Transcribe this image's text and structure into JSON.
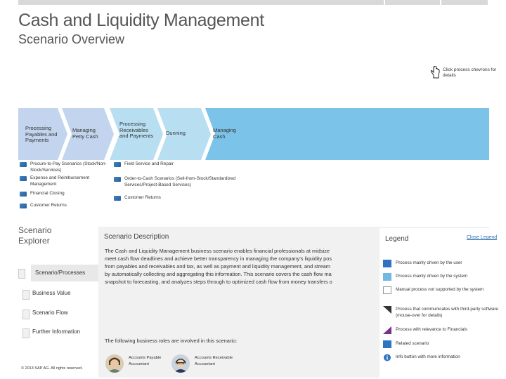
{
  "header": {
    "title": "Cash and Liquidity Management",
    "subtitle": "Scenario Overview"
  },
  "hint": {
    "text": "Click process chevrons for details",
    "icon": "pointer-hand-icon"
  },
  "process_steps": [
    {
      "label": "Processing Payables and Payments",
      "color": "#c3d5ee"
    },
    {
      "label": "Managing Petty Cash",
      "color": "#c3d5ee"
    },
    {
      "label": "Processing Receivables and Payments",
      "color": "#b8def2"
    },
    {
      "label": "Dunning",
      "color": "#b8def2"
    },
    {
      "label": "Managing Cash",
      "color": "#7cc3e9"
    }
  ],
  "connected_scenarios_left": [
    "Procure-to-Pay Scenarios (Stock/Non-Stock/Services)",
    "Expense and Reimbursement Management",
    "Financial Closing",
    "Customer Returns"
  ],
  "connected_scenarios_right": [
    "Field Service and Repair",
    "Order-to-Cash Scenarios (Sell-from-Stock/Standardized Services/Project-Based Services)",
    "Customer Returns"
  ],
  "explorer": {
    "title": "Scenario Explorer",
    "items": [
      "Scenario/Processes",
      "Business Value",
      "Scenario Flow",
      "Further Information"
    ],
    "selected": "Scenario/Processes"
  },
  "copyright": "© 2013 SAP AG. All rights reserved.",
  "description": {
    "heading": "Scenario Description",
    "lines": [
      "The Cash and Liquidity Management business scenario enables financial professionals at midsize",
      "meet cash flow deadlines and achieve better transparency in managing the company's liquidity pos",
      "from payables and receivables and tax, as well as payment and liquidity management, and stream",
      "by automatically collecting and aggregating this information. This scenario covers the cash flow ma",
      "snapshot to forecasting, and analyzes steps through to optimized cash flow from money transfers o"
    ],
    "roles_heading": "The following business roles are involved in this scenario:",
    "roles": [
      "Accounts Payable Accountant",
      "Accounts Receivable Accountant"
    ]
  },
  "legend": {
    "title": "Legend",
    "close_label": "Close Legend",
    "items": [
      {
        "icon": "user-process-icon",
        "text": "Process mainly driven by the user"
      },
      {
        "icon": "system-process-icon",
        "text": "Process mainly driven by the system"
      },
      {
        "icon": "manual-process-icon",
        "text": "Manual process not supported by the system"
      },
      {
        "icon": "third-party-icon",
        "text": "Process that communicates with third-party software (mouse-over for details)"
      },
      {
        "icon": "financials-icon",
        "text": "Process with relevance to Financials"
      },
      {
        "icon": "related-scenario-icon",
        "text": "Related scenario"
      },
      {
        "icon": "info-icon",
        "text": "Info button with more information"
      }
    ]
  }
}
